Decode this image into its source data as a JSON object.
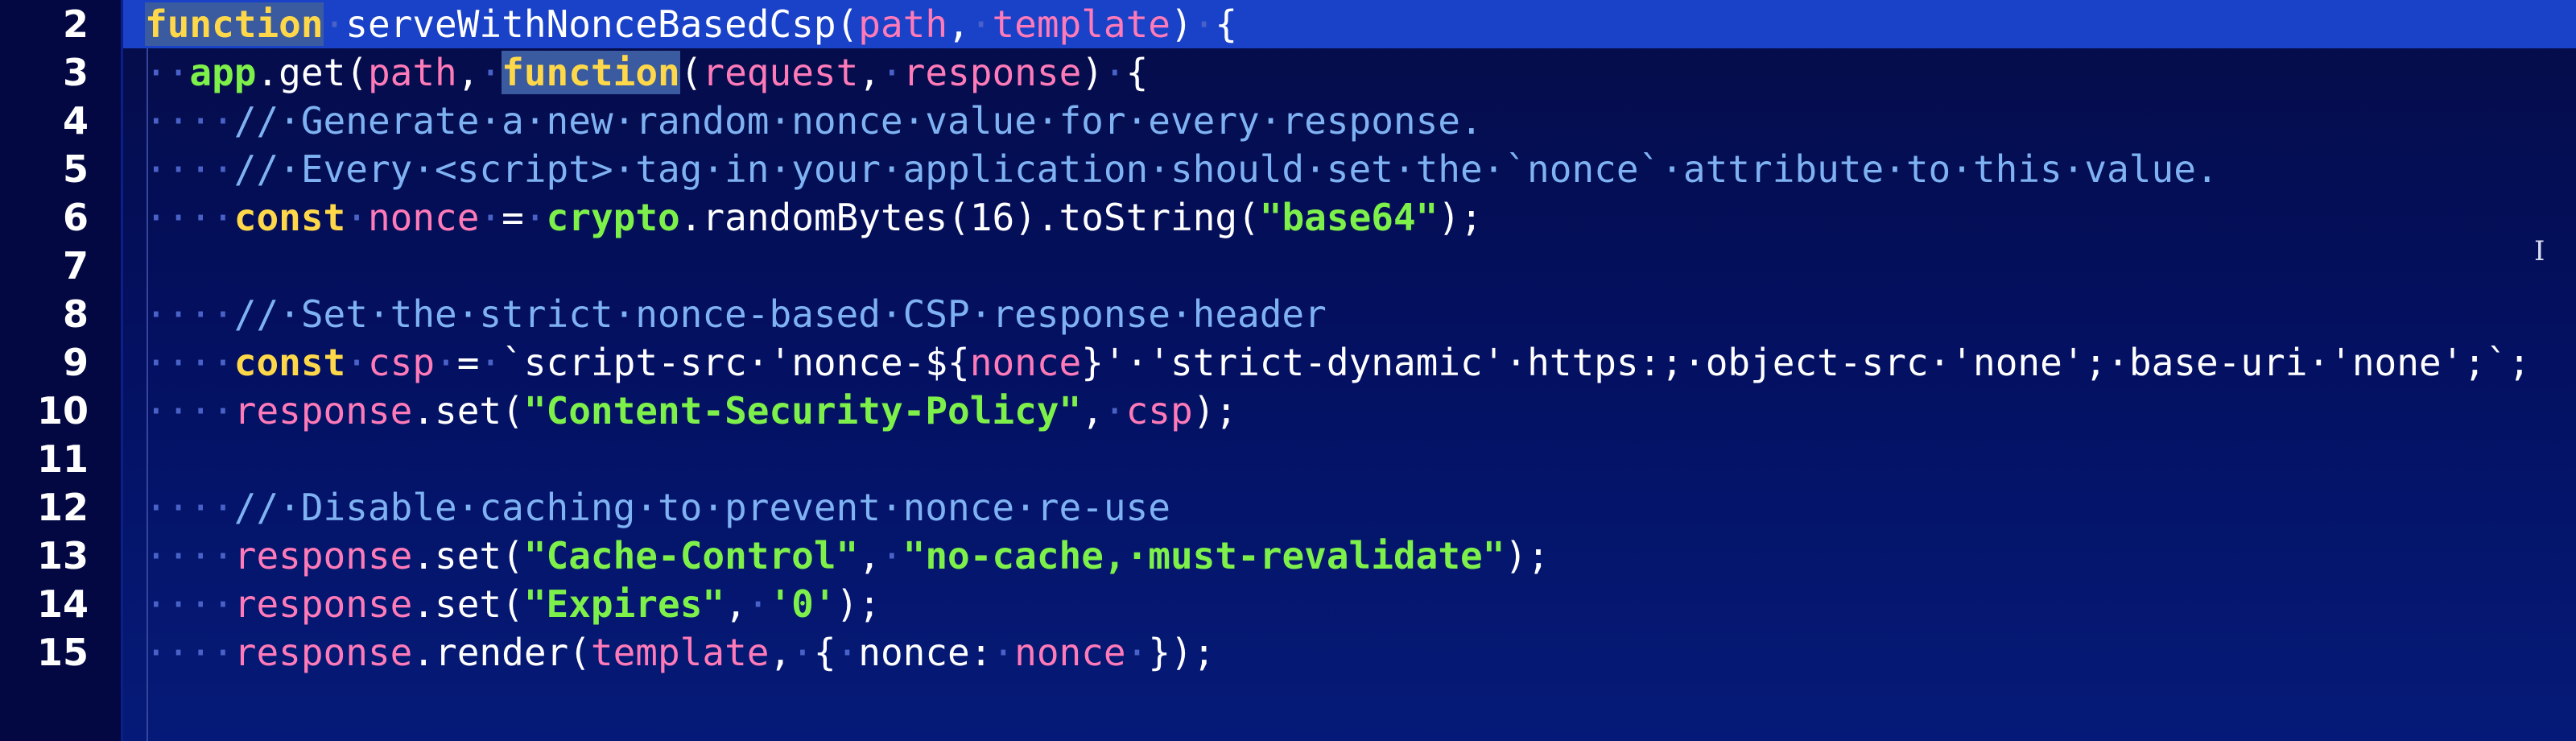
{
  "editor": {
    "language": "javascript",
    "active_line": "2",
    "cursor_icon": "I",
    "colors": {
      "background": "#041060",
      "gutter": "#030842",
      "active_line_highlight": "#1a42c8",
      "keyword": "#ffd84a",
      "parameter": "#ff7ab8",
      "string": "#7df04a",
      "comment": "#7fb2f2",
      "whitespace_dot": "#4a62c8"
    },
    "lines": [
      {
        "number": "2",
        "tokens": [
          {
            "t": "keyword-hl",
            "v": "function"
          },
          {
            "t": "dot",
            "v": "·"
          },
          {
            "t": "funcname",
            "v": "serveWithNonceBasedCsp"
          },
          {
            "t": "punct",
            "v": "("
          },
          {
            "t": "param",
            "v": "path"
          },
          {
            "t": "punct",
            "v": ","
          },
          {
            "t": "dot",
            "v": "·"
          },
          {
            "t": "param",
            "v": "template"
          },
          {
            "t": "punct",
            "v": ")"
          },
          {
            "t": "dot",
            "v": "·"
          },
          {
            "t": "punct",
            "v": "{"
          }
        ]
      },
      {
        "number": "3",
        "tokens": [
          {
            "t": "dot",
            "v": "··"
          },
          {
            "t": "obj",
            "v": "app"
          },
          {
            "t": "method",
            "v": ".get("
          },
          {
            "t": "param",
            "v": "path"
          },
          {
            "t": "punct",
            "v": ","
          },
          {
            "t": "dot",
            "v": "·"
          },
          {
            "t": "keyword-hl",
            "v": "function"
          },
          {
            "t": "punct",
            "v": "("
          },
          {
            "t": "param",
            "v": "request"
          },
          {
            "t": "punct",
            "v": ","
          },
          {
            "t": "dot",
            "v": "·"
          },
          {
            "t": "param",
            "v": "response"
          },
          {
            "t": "punct",
            "v": ")"
          },
          {
            "t": "dot",
            "v": "·"
          },
          {
            "t": "punct",
            "v": "{"
          }
        ]
      },
      {
        "number": "4",
        "tokens": [
          {
            "t": "dot",
            "v": "····"
          },
          {
            "t": "comment",
            "v": "//·Generate·a·new·random·nonce·value·for·every·response."
          }
        ]
      },
      {
        "number": "5",
        "tokens": [
          {
            "t": "dot",
            "v": "····"
          },
          {
            "t": "comment",
            "v": "//·Every·<script>·tag·in·your·application·should·set·the·`nonce`·attribute·to·this·value."
          }
        ]
      },
      {
        "number": "6",
        "tokens": [
          {
            "t": "dot",
            "v": "····"
          },
          {
            "t": "keyword",
            "v": "const"
          },
          {
            "t": "dot",
            "v": "·"
          },
          {
            "t": "param",
            "v": "nonce"
          },
          {
            "t": "dot",
            "v": "·"
          },
          {
            "t": "punct",
            "v": "="
          },
          {
            "t": "dot",
            "v": "·"
          },
          {
            "t": "obj",
            "v": "crypto"
          },
          {
            "t": "method",
            "v": ".randomBytes(16).toString("
          },
          {
            "t": "string",
            "v": "\"base64\""
          },
          {
            "t": "punct",
            "v": ");"
          }
        ]
      },
      {
        "number": "7",
        "tokens": []
      },
      {
        "number": "8",
        "tokens": [
          {
            "t": "dot",
            "v": "····"
          },
          {
            "t": "comment",
            "v": "//·Set·the·strict·nonce-based·CSP·response·header"
          }
        ]
      },
      {
        "number": "9",
        "tokens": [
          {
            "t": "dot",
            "v": "····"
          },
          {
            "t": "keyword",
            "v": "const"
          },
          {
            "t": "dot",
            "v": "·"
          },
          {
            "t": "param",
            "v": "csp"
          },
          {
            "t": "dot",
            "v": "·"
          },
          {
            "t": "punct",
            "v": "="
          },
          {
            "t": "dot",
            "v": "·"
          },
          {
            "t": "template",
            "v": "`script-src·'nonce-${"
          },
          {
            "t": "interp",
            "v": "nonce"
          },
          {
            "t": "template",
            "v": "}'·'strict-dynamic'·https:;·object-src·'none';·base-uri·'none';`;"
          }
        ]
      },
      {
        "number": "10",
        "tokens": [
          {
            "t": "dot",
            "v": "····"
          },
          {
            "t": "param",
            "v": "response"
          },
          {
            "t": "method",
            "v": ".set("
          },
          {
            "t": "string",
            "v": "\"Content-Security-Policy\""
          },
          {
            "t": "punct",
            "v": ","
          },
          {
            "t": "dot",
            "v": "·"
          },
          {
            "t": "param",
            "v": "csp"
          },
          {
            "t": "punct",
            "v": ");"
          }
        ]
      },
      {
        "number": "11",
        "tokens": []
      },
      {
        "number": "12",
        "tokens": [
          {
            "t": "dot",
            "v": "····"
          },
          {
            "t": "comment",
            "v": "//·Disable·caching·to·prevent·nonce·re-use"
          }
        ]
      },
      {
        "number": "13",
        "tokens": [
          {
            "t": "dot",
            "v": "····"
          },
          {
            "t": "param",
            "v": "response"
          },
          {
            "t": "method",
            "v": ".set("
          },
          {
            "t": "string",
            "v": "\"Cache-Control\""
          },
          {
            "t": "punct",
            "v": ","
          },
          {
            "t": "dot",
            "v": "·"
          },
          {
            "t": "string",
            "v": "\"no-cache,·must-revalidate\""
          },
          {
            "t": "punct",
            "v": ");"
          }
        ]
      },
      {
        "number": "14",
        "tokens": [
          {
            "t": "dot",
            "v": "····"
          },
          {
            "t": "param",
            "v": "response"
          },
          {
            "t": "method",
            "v": ".set("
          },
          {
            "t": "string",
            "v": "\"Expires\""
          },
          {
            "t": "punct",
            "v": ","
          },
          {
            "t": "dot",
            "v": "·"
          },
          {
            "t": "string",
            "v": "'0'"
          },
          {
            "t": "punct",
            "v": ");"
          }
        ]
      },
      {
        "number": "15",
        "tokens": [
          {
            "t": "dot",
            "v": "····"
          },
          {
            "t": "param",
            "v": "response"
          },
          {
            "t": "method",
            "v": ".render("
          },
          {
            "t": "param",
            "v": "template"
          },
          {
            "t": "punct",
            "v": ","
          },
          {
            "t": "dot",
            "v": "·"
          },
          {
            "t": "punct",
            "v": "{"
          },
          {
            "t": "dot",
            "v": "·"
          },
          {
            "t": "method",
            "v": "nonce:"
          },
          {
            "t": "dot",
            "v": "·"
          },
          {
            "t": "param",
            "v": "nonce"
          },
          {
            "t": "dot",
            "v": "·"
          },
          {
            "t": "punct",
            "v": "});"
          }
        ]
      }
    ]
  }
}
